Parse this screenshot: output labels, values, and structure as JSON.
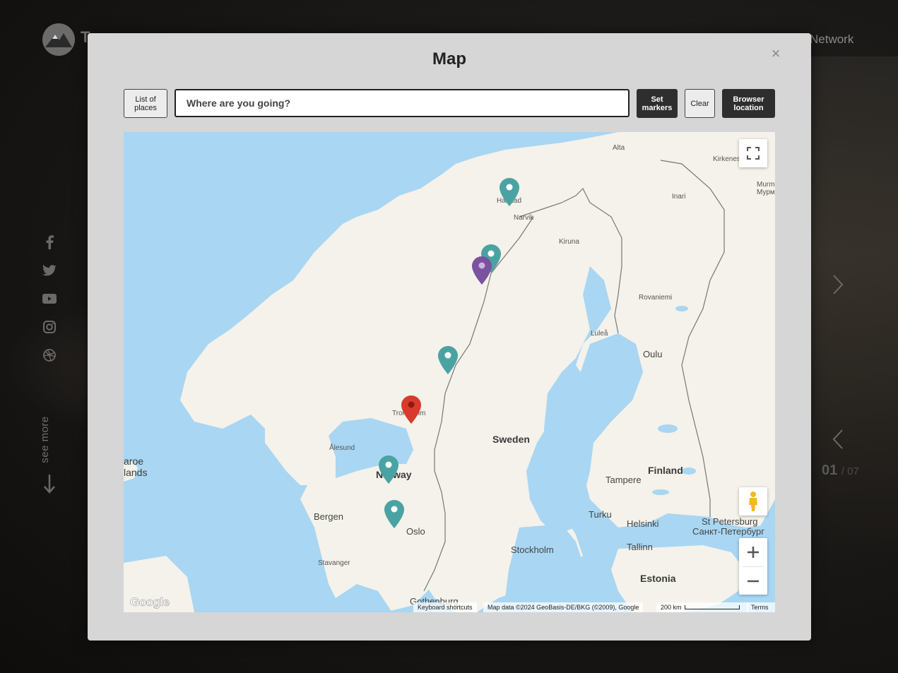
{
  "background": {
    "logo_letter": "T",
    "nav_right": "Network",
    "see_more": "see more",
    "counter_current": "01",
    "counter_total": "/ 07"
  },
  "modal": {
    "title": "Map",
    "close": "×",
    "toolbar": {
      "list_places": "List of places",
      "search_placeholder": "Where are you going?",
      "set_markers": "Set markers",
      "clear": "Clear",
      "browser_location": "Browser location"
    }
  },
  "map": {
    "labels": {
      "alta": "Alta",
      "kirkenes": "Kirkenes",
      "murm": "Murm",
      "murm_cyr": "Мурм",
      "inari": "Inari",
      "harstad": "Harstad",
      "narvik": "Narvik",
      "kiruna": "Kiruna",
      "rovaniemi": "Rovaniemi",
      "lulea": "Luleå",
      "oulu": "Oulu",
      "trondheim": "Trondheim",
      "alesund": "Ålesund",
      "faroe1": "aroe",
      "faroe2": "lands",
      "sweden": "Sweden",
      "norway": "Norway",
      "finland": "Finland",
      "tampere": "Tampere",
      "bergen": "Bergen",
      "oslo": "Oslo",
      "turku": "Turku",
      "helsinki": "Helsinki",
      "stpete": "St Petersburg",
      "stpete_cyr": "Санкт-Петербург",
      "stockholm": "Stockholm",
      "tallinn": "Tallinn",
      "stavanger": "Stavanger",
      "estonia": "Estonia",
      "gothenburg": "Gothenburg"
    },
    "footer": {
      "shortcuts": "Keyboard shortcuts",
      "attribution": "Map data ©2024 GeoBasis-DE/BKG (©2009), Google",
      "scale": "200 km",
      "terms": "Terms"
    },
    "google": "Google",
    "colors": {
      "water": "#a9d6f2",
      "land": "#f4f2ea",
      "pin_teal": "#4aa3a2",
      "pin_purple": "#7a52a0",
      "pin_red": "#d93a2b"
    }
  }
}
